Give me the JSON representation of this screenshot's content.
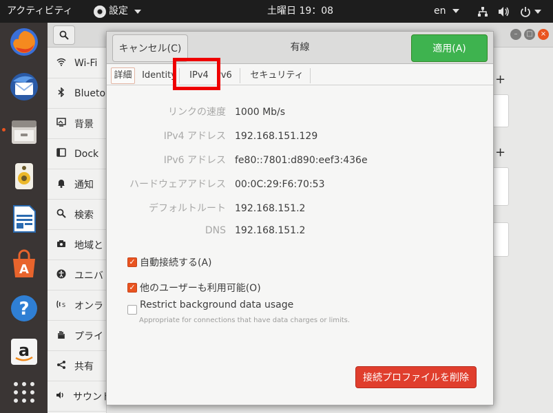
{
  "topbar": {
    "activities": "アクティビティ",
    "app_name": "設定",
    "clock": "土曜日 19：08",
    "language": "en",
    "icons": [
      "network-wired-icon",
      "volume-icon",
      "power-icon",
      "chevron-down-icon"
    ]
  },
  "dock": {
    "apps": [
      "firefox",
      "thunderbird",
      "files",
      "rhythmbox",
      "writer",
      "software-center",
      "help",
      "amazon",
      "app-grid"
    ]
  },
  "settings": {
    "sidebar": [
      {
        "label": "Wi-Fi",
        "icon": "wifi-icon"
      },
      {
        "label": "Blueto",
        "icon": "bluetooth-icon"
      },
      {
        "label": "背景",
        "icon": "background-icon"
      },
      {
        "label": "Dock",
        "icon": "dock-icon"
      },
      {
        "label": "通知",
        "icon": "bell-icon"
      },
      {
        "label": "検索",
        "icon": "search-icon"
      },
      {
        "label": "地域と",
        "icon": "camera-icon"
      },
      {
        "label": "ユニバ",
        "icon": "accessibility-icon"
      },
      {
        "label": "オンラ",
        "icon": "online-accounts-icon"
      },
      {
        "label": "プライ",
        "icon": "hand-icon"
      },
      {
        "label": "共有",
        "icon": "share-icon"
      },
      {
        "label": "サウンド",
        "icon": "sound-icon"
      }
    ]
  },
  "dialog": {
    "title": "有線",
    "cancel_label": "キャンセル(C)",
    "apply_label": "適用(A)",
    "tabs": [
      "詳細",
      "Identity",
      "IPv4",
      "IPv6",
      "セキュリティ"
    ],
    "details": [
      {
        "label": "リンクの速度",
        "value": "1000 Mb/s"
      },
      {
        "label": "IPv4 アドレス",
        "value": "192.168.151.129"
      },
      {
        "label": "IPv6 アドレス",
        "value": "fe80::7801:d890:eef3:436e"
      },
      {
        "label": "ハードウェアアドレス",
        "value": "00:0C:29:F6:70:53"
      },
      {
        "label": "デフォルトルート",
        "value": "192.168.151.2"
      },
      {
        "label": "DNS",
        "value": "192.168.151.2"
      }
    ],
    "checkboxes": [
      {
        "label": "自動接続する(A)",
        "checked": true
      },
      {
        "label": "他のユーザーも利用可能(O)",
        "checked": true
      },
      {
        "label": "Restrict background data usage",
        "checked": false
      }
    ],
    "restrict_sub": "Appropriate for connections that have data charges or limits.",
    "delete_label": "接続プロファイルを削除"
  },
  "colors": {
    "accent": "#e95420",
    "apply_green": "#3eb34f",
    "delete_red": "#e03e2d",
    "highlight_box": "#ee0000"
  }
}
